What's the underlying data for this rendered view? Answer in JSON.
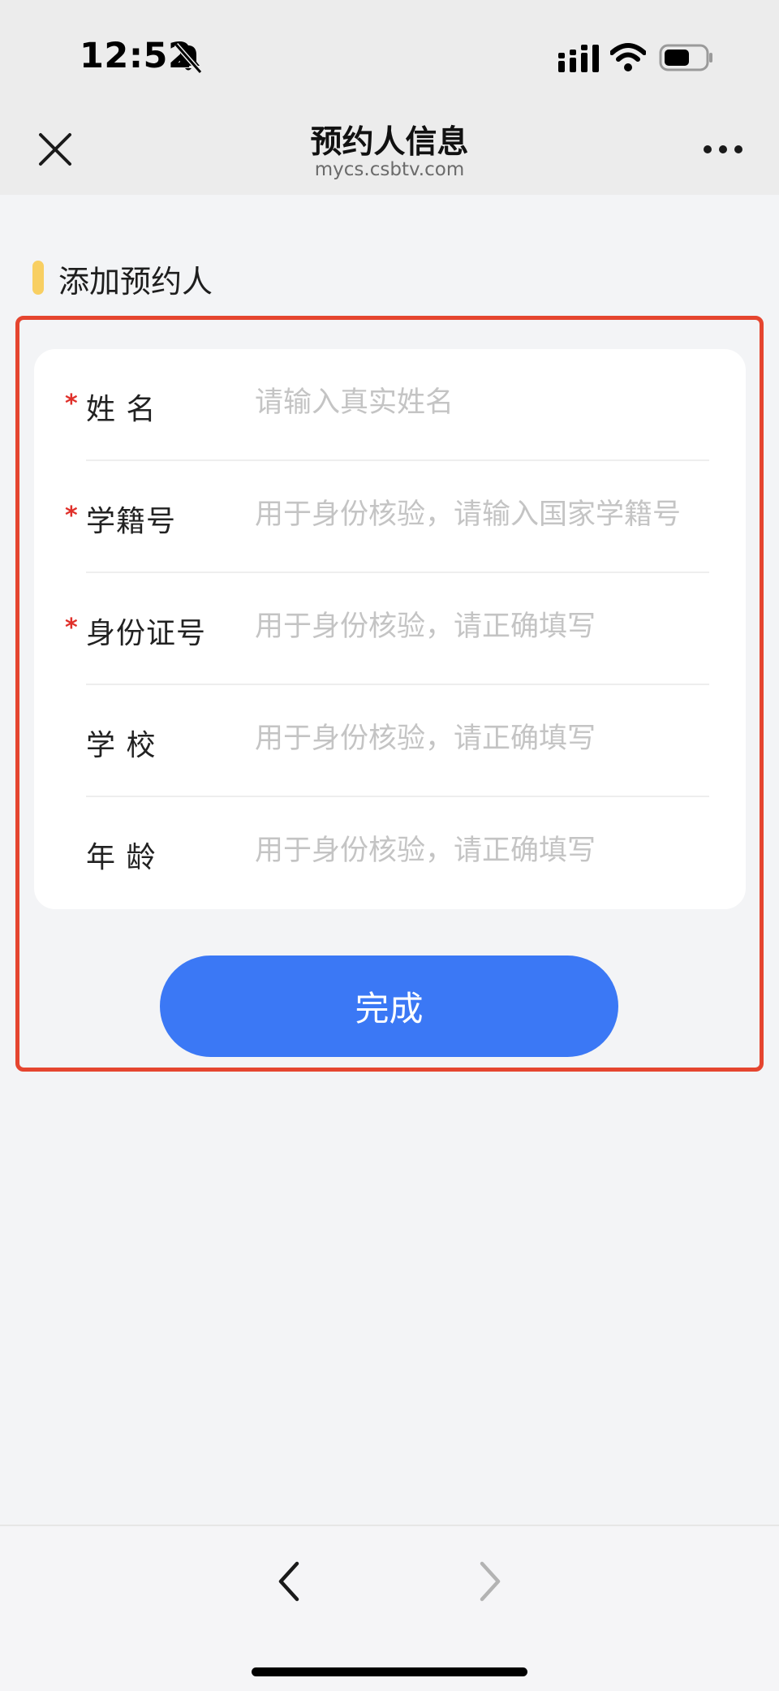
{
  "status_bar": {
    "time": "12:52"
  },
  "nav": {
    "title": "预约人信息",
    "subtitle": "mycs.csbtv.com"
  },
  "section": {
    "title": "添加预约人"
  },
  "form": {
    "fields": [
      {
        "label": "姓 名",
        "required": true,
        "required_mark": "*",
        "placeholder": "请输入真实姓名",
        "value": ""
      },
      {
        "label": "学籍号",
        "required": true,
        "required_mark": "*",
        "placeholder": "用于身份核验，请输入国家学籍号",
        "value": ""
      },
      {
        "label": "身份证号",
        "required": true,
        "required_mark": "*",
        "placeholder": "用于身份核验，请正确填写",
        "value": ""
      },
      {
        "label": "学 校",
        "required": false,
        "required_mark": "",
        "placeholder": "用于身份核验，请正确填写",
        "value": ""
      },
      {
        "label": "年 龄",
        "required": false,
        "required_mark": "",
        "placeholder": "用于身份核验，请正确填写",
        "value": ""
      }
    ],
    "submit_label": "完成"
  },
  "icons": {
    "close": "close-icon",
    "more": "more-icon",
    "back": "chevron-left-icon",
    "forward": "chevron-right-icon",
    "bell_muted": "bell-slash-icon",
    "signal": "signal-icon",
    "wifi": "wifi-icon",
    "battery": "battery-icon"
  },
  "colors": {
    "accent": "#3b78f5",
    "section_marker": "#f8cf62",
    "highlight_frame": "#e5452f",
    "required": "#e0302a"
  }
}
